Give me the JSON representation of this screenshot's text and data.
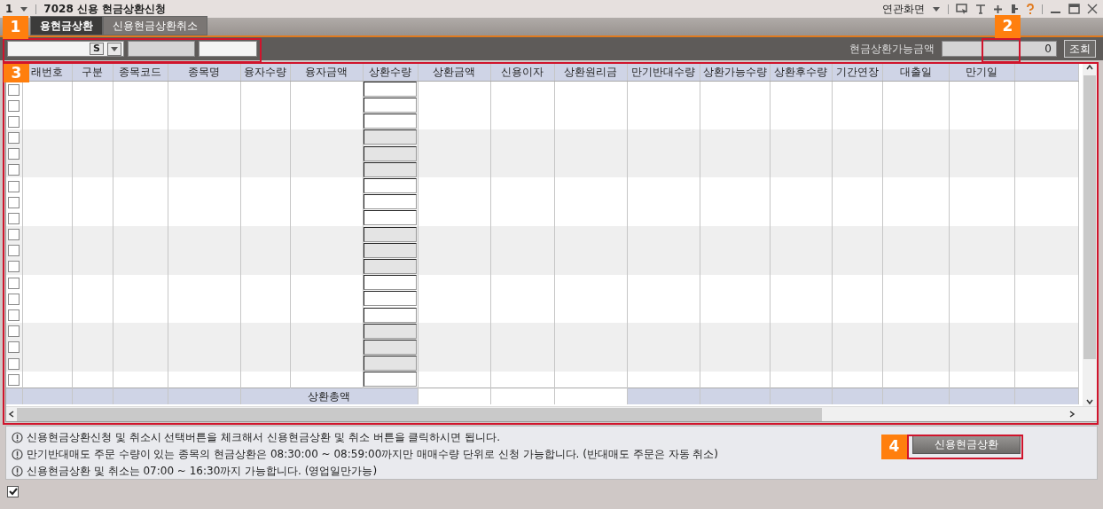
{
  "window": {
    "screen_number": "1",
    "title": "7028 신용 현금상환신청",
    "related_menu": "연관화면"
  },
  "tabs": [
    {
      "label": "용현금상환",
      "selected": true
    },
    {
      "label": "신용현금상환취소",
      "selected": false
    }
  ],
  "filter": {
    "available_label": "현금상환가능금액",
    "available_value": "0",
    "query_button": "조회",
    "combo_button": "S"
  },
  "table": {
    "columns": [
      "래번호",
      "구분",
      "종목코드",
      "종목명",
      "융자수량",
      "융자금액",
      "상환수량",
      "상환금액",
      "신용이자",
      "상환원리금",
      "만기반대수량",
      "상환가능수량",
      "상환후수량",
      "기간연장",
      "대출일",
      "만기일"
    ],
    "rows": [
      {
        "checked": false
      },
      {
        "checked": false
      },
      {
        "checked": false
      },
      {
        "checked": false
      },
      {
        "checked": false
      },
      {
        "checked": false
      },
      {
        "checked": false
      },
      {
        "checked": false
      },
      {
        "checked": false
      },
      {
        "checked": false
      },
      {
        "checked": false
      },
      {
        "checked": false
      },
      {
        "checked": false
      },
      {
        "checked": false
      },
      {
        "checked": false
      },
      {
        "checked": false
      },
      {
        "checked": false
      },
      {
        "checked": false
      },
      {
        "checked": false
      }
    ],
    "total_label": "상환총액"
  },
  "notes": [
    "신용현금상환신청 및 취소시 선택버튼을 체크해서 신용현금상환 및 취소 버튼을 클릭하시면 됩니다.",
    "만기반대매도 주문 수량이 있는 종목의 현금상환은 08:30:00 ~ 08:59:00까지만 매매수량 단위로 신청 가능합니다. (반대매도 주문은 자동 취소)",
    "신용현금상환 및 취소는 07:00 ~ 16:30까지 가능합니다. (영업일만가능)"
  ],
  "submit_button": "신용현금상환",
  "footer_checkbox": {
    "checked": true
  },
  "callouts": [
    {
      "label": "1"
    },
    {
      "label": "2"
    },
    {
      "label": "3"
    },
    {
      "label": "4"
    }
  ]
}
